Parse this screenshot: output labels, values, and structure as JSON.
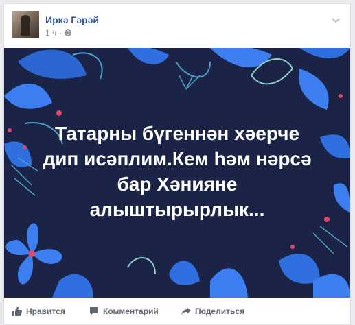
{
  "post": {
    "author": "Иркә Гәрәй",
    "time": "1 ч",
    "time_separator": "·",
    "privacy_icon": "globe-icon",
    "menu_icon": "chevron-down-icon"
  },
  "image": {
    "background": "#1b2446",
    "accent": "#2f6fe0",
    "lines": [
      "Татарны бүгеннән хәерче",
      "дип исәплим.Кем һәм нәрсә",
      "бар Хәнияне",
      "алыштырырлык..."
    ]
  },
  "actions": {
    "like": "Нравится",
    "comment": "Комментарий",
    "share": "Поделиться"
  }
}
